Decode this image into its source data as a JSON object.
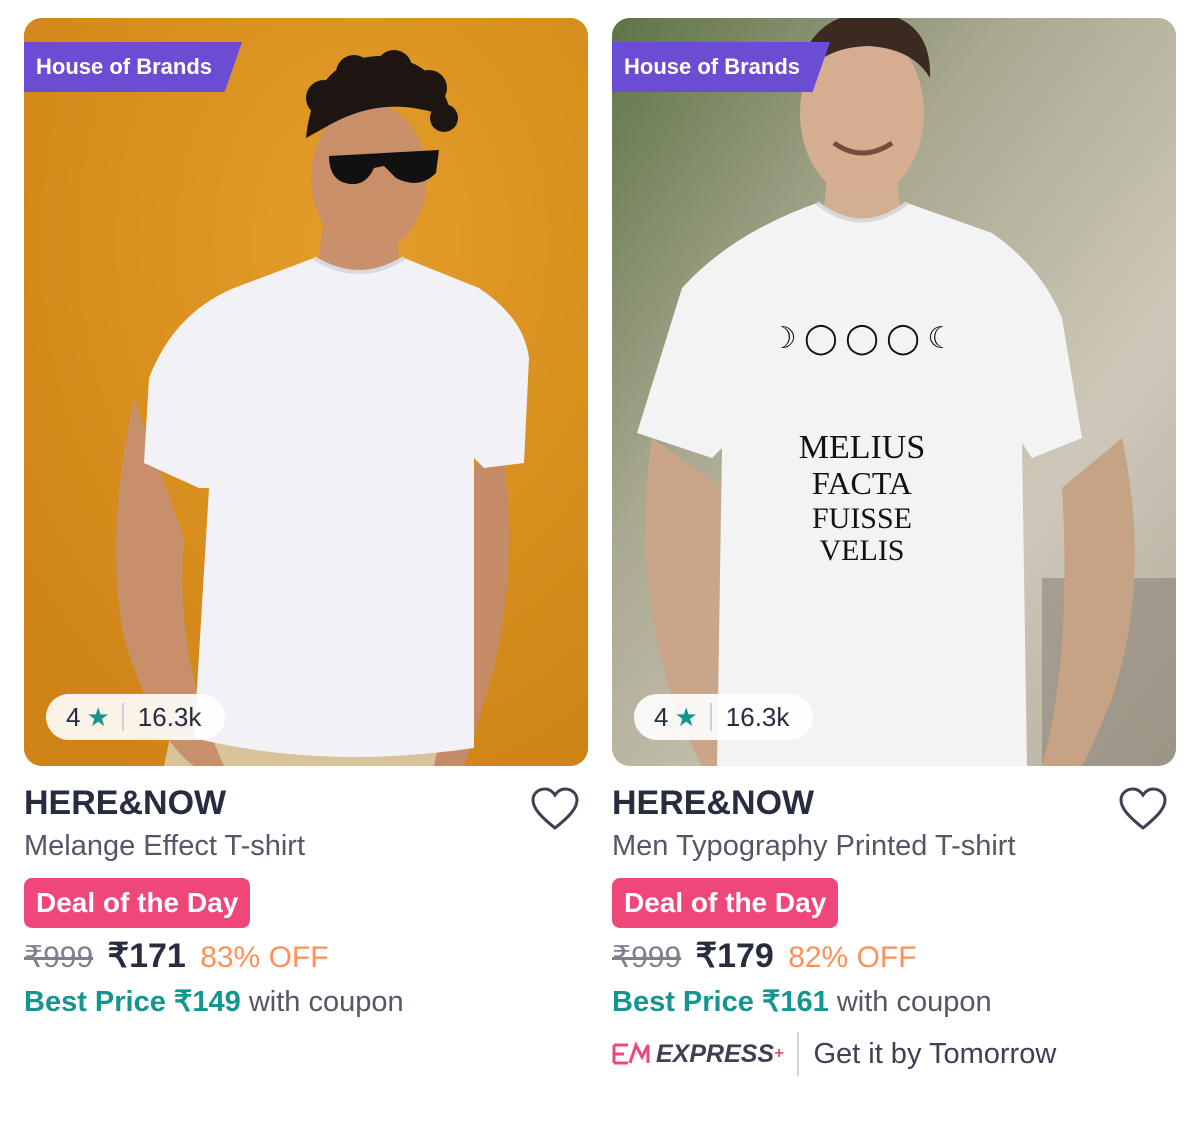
{
  "products": [
    {
      "badge": "House of Brands",
      "rating": "4",
      "rating_count": "16.3k",
      "brand": "HERE&NOW",
      "description": "Melange Effect T-shirt",
      "deal_label": "Deal of the Day",
      "mrp": "₹999",
      "price": "₹171",
      "discount": "83% OFF",
      "best_price_label": "Best Price ₹149",
      "best_price_suffix": "with coupon"
    },
    {
      "badge": "House of Brands",
      "rating": "4",
      "rating_count": "16.3k",
      "brand": "HERE&NOW",
      "description": "Men Typography Printed T-shirt",
      "deal_label": "Deal of the Day",
      "mrp": "₹999",
      "price": "₹179",
      "discount": "82% OFF",
      "best_price_label": "Best Price ₹161",
      "best_price_suffix": "with coupon",
      "express_logo": "EXPRESS",
      "express_plus": "+",
      "delivery": "Get it by Tomorrow",
      "shirt_print": [
        "MELIUS",
        "FACTA",
        "FUISSE",
        "VELIS"
      ]
    }
  ],
  "colors": {
    "badge_bg": "#6b4dd3",
    "deal_bg": "#f0477a",
    "discount": "#ff905a",
    "best_price": "#14958f",
    "star": "#14958f"
  },
  "icons": [
    "star-icon",
    "heart-icon",
    "express-logo-icon"
  ]
}
